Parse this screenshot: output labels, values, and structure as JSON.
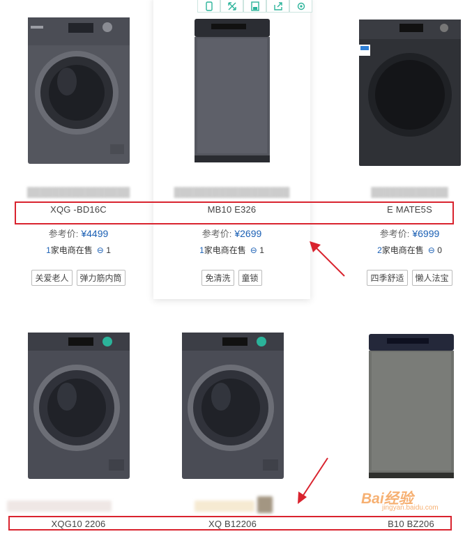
{
  "toolbar": {
    "icons": [
      "phone-icon",
      "expand-icon",
      "save-icon",
      "share-icon",
      "settings-icon"
    ]
  },
  "products": [
    {
      "model": "XQG     -BD16C",
      "price_label": "参考价:",
      "price": "¥4499",
      "stores_num": "1",
      "stores_text": "家电商在售",
      "comments": "1",
      "tags": [
        "关爱老人",
        "弹力筋内筒"
      ]
    },
    {
      "model": "MB10    E326",
      "price_label": "参考价:",
      "price": "¥2699",
      "stores_num": "1",
      "stores_text": "家电商在售",
      "comments": "1",
      "tags": [
        "免清洗",
        "童锁"
      ]
    },
    {
      "model": "E      MATE5S",
      "price_label": "参考价:",
      "price": "¥6999",
      "stores_num": "2",
      "stores_text": "家电商在售",
      "comments": "0",
      "tags": [
        "四季舒适",
        "懒人法宝"
      ]
    },
    {
      "model": "XQG10      2206"
    },
    {
      "model": "XQ        B12206"
    },
    {
      "model": "      B10   BZ206"
    }
  ],
  "watermark": {
    "text": "Bai经验",
    "sub": "jingyan.baidu.com"
  },
  "colors": {
    "accent_blue": "#1a5fb4",
    "highlight_red": "#d9232e",
    "toolbar_teal": "#2bb39a",
    "washer_dark": "#4a4c55"
  }
}
